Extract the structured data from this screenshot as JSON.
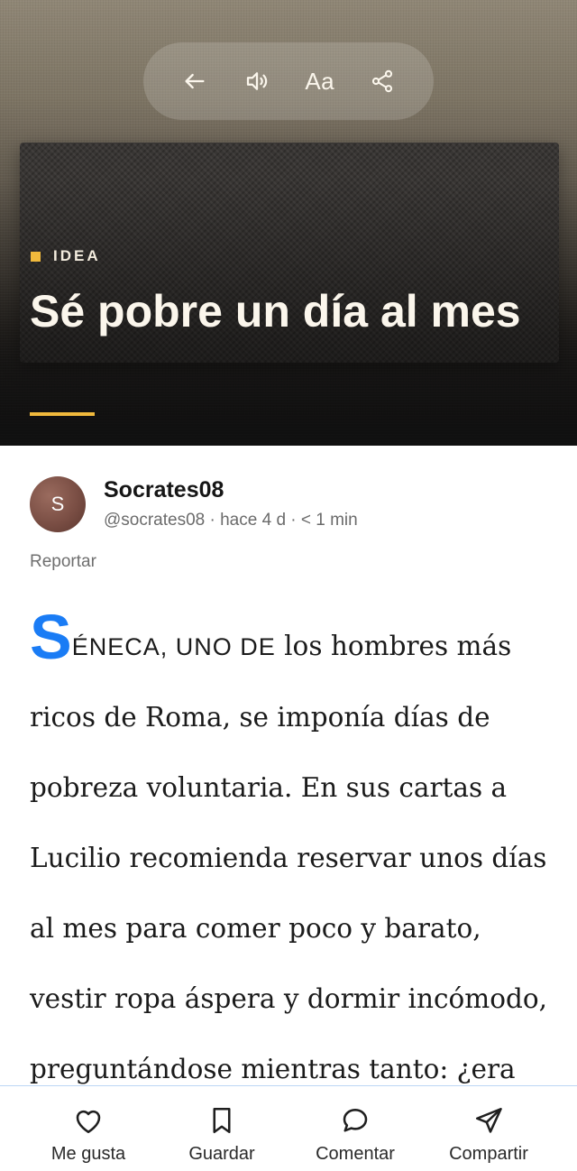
{
  "toolbar": {
    "icons": [
      "back-arrow-icon",
      "speaker-icon",
      "text-size-icon",
      "share-icon"
    ],
    "text_size_label": "Aa"
  },
  "hero": {
    "category": "IDEA",
    "title": "Sé pobre un día al mes",
    "accent_color": "#f0b93c"
  },
  "author": {
    "initial": "S",
    "name": "Socrates08",
    "meta": "@socrates08 · hace 4 d · < 1 min",
    "report_label": "Reportar"
  },
  "article": {
    "dropcap": "S",
    "lead": "ÉNECA, UNO DE",
    "body": " los hombres más ricos de Roma, se imponía días de pobreza voluntaria. En sus cartas a Lucilio recomienda reservar unos días al mes para comer poco y barato, vestir ropa áspera y dormir incómodo, preguntándose mientras tanto: ¿era",
    "dropcap_color": "#1a7cf5"
  },
  "bottom_bar": {
    "like": "Me gusta",
    "save": "Guardar",
    "comment": "Comentar",
    "share": "Compartir"
  }
}
